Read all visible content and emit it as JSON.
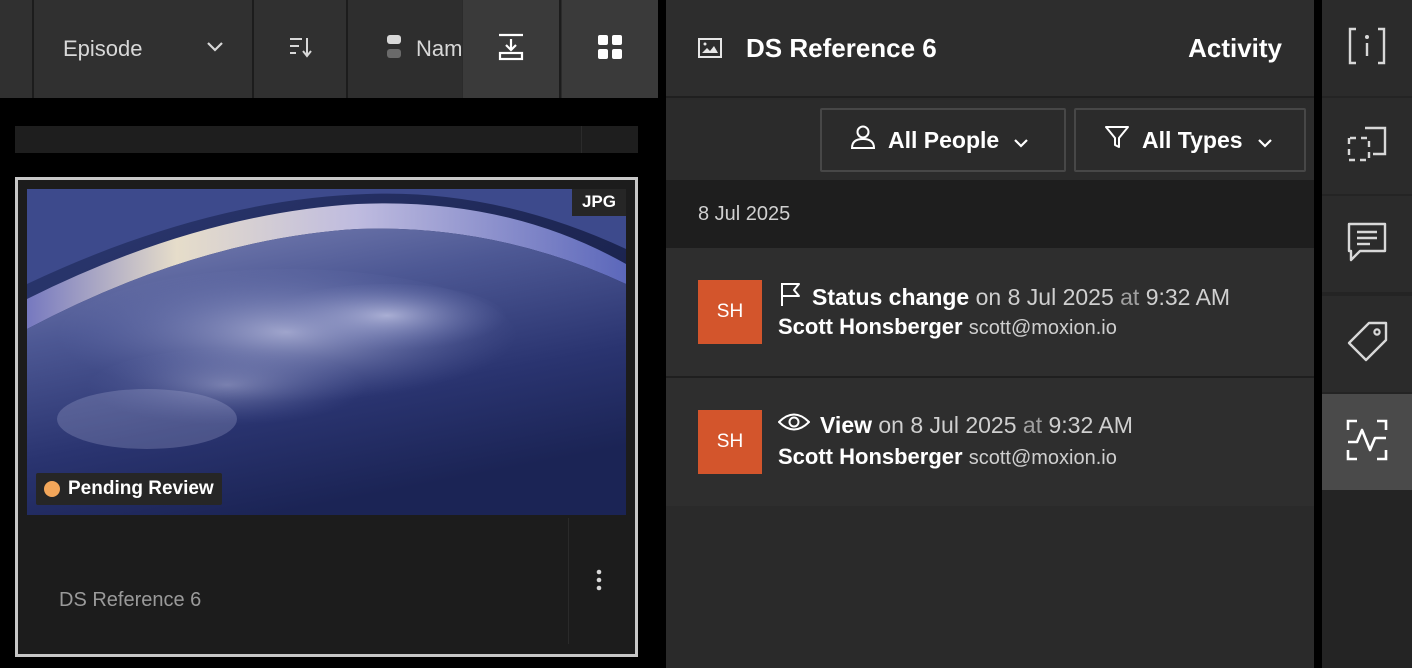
{
  "toolbar": {
    "group_by_label": "Episode",
    "sort_label": "Name"
  },
  "card": {
    "format_badge": "JPG",
    "status": "Pending Review",
    "title": "DS Reference 6",
    "status_color": "#f2a65a"
  },
  "panel": {
    "asset_title": "DS Reference 6",
    "section_title": "Activity",
    "filters": {
      "people_label": "All People",
      "types_label": "All Types"
    },
    "date_group": "8 Jul 2025",
    "activities": [
      {
        "initials": "SH",
        "icon": "flag-icon",
        "action": "Status change",
        "on_word": "on",
        "date": "8 Jul 2025",
        "at_word": "at",
        "time": "9:32 AM",
        "user_name": "Scott Honsberger",
        "user_email": "scott@moxion.io"
      },
      {
        "initials": "SH",
        "icon": "eye-icon",
        "action": "View",
        "on_word": "on",
        "date": "8 Jul 2025",
        "at_word": "at",
        "time": "9:32 AM",
        "user_name": "Scott Honsberger",
        "user_email": "scott@moxion.io"
      }
    ]
  },
  "rail": {
    "items": [
      "info-icon",
      "compare-icon",
      "comment-icon",
      "tag-icon",
      "activity-icon"
    ],
    "active_item": "activity-icon"
  },
  "colors": {
    "avatar": "#d3552c",
    "active_rail": "#4a4a4a"
  }
}
